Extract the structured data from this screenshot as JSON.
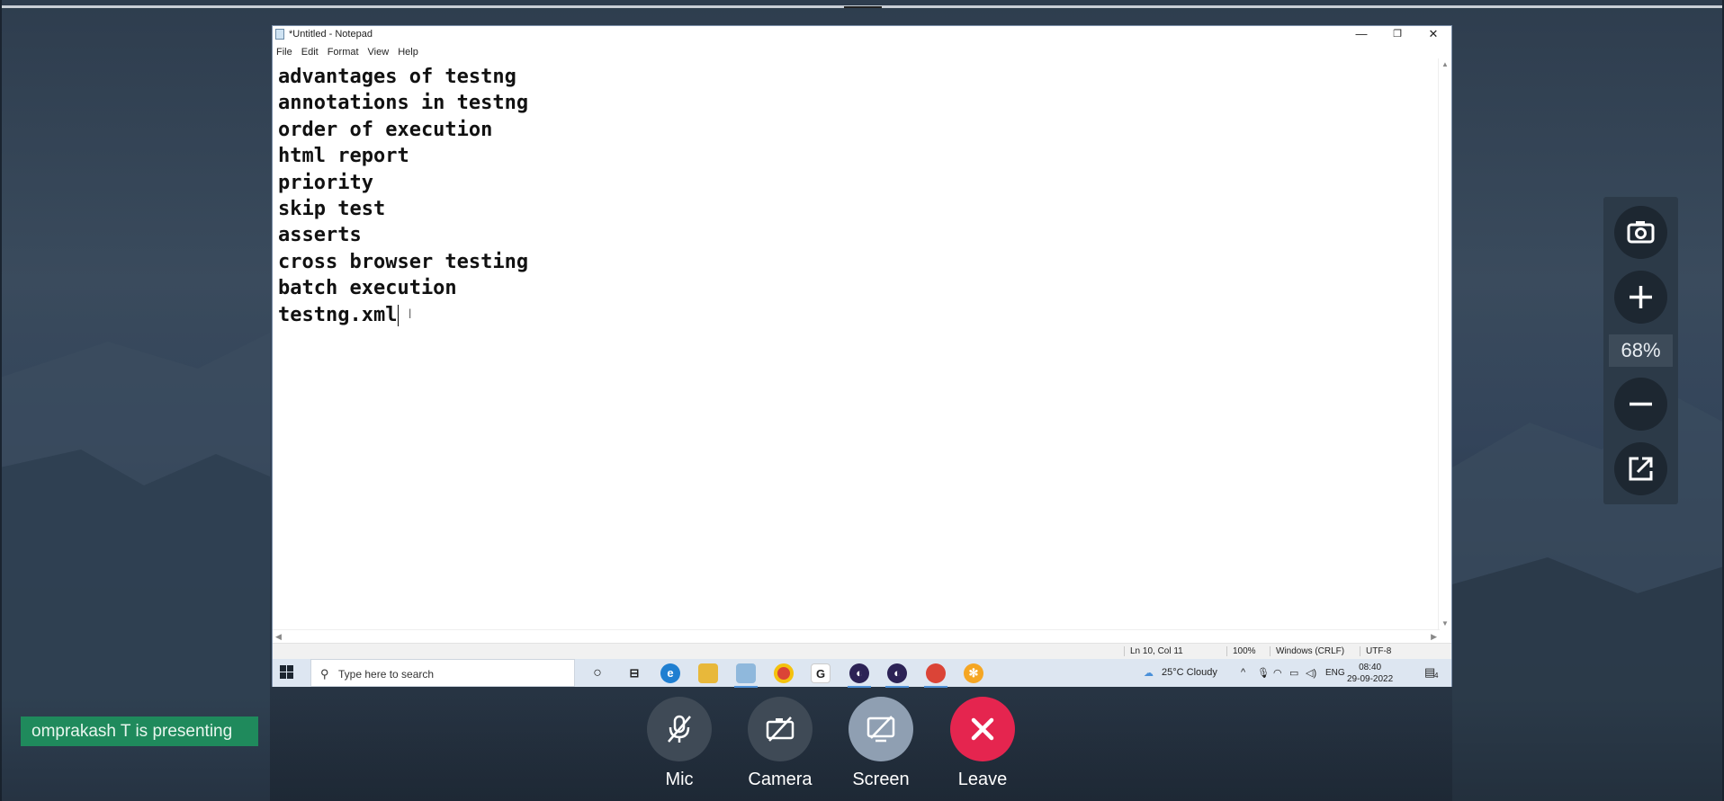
{
  "notepad": {
    "title": "*Untitled - Notepad",
    "menu": [
      "File",
      "Edit",
      "Format",
      "View",
      "Help"
    ],
    "controls": {
      "minimize": "—",
      "maximize": "❐",
      "close": "✕"
    },
    "lines": [
      "advantages of testng",
      "annotations in testng",
      "order of execution",
      "html report",
      "priority",
      "skip test",
      "asserts",
      "cross browser testing",
      "batch execution",
      "testng.xml"
    ],
    "status": {
      "position": "Ln 10, Col 11",
      "zoom": "100%",
      "line_ending": "Windows (CRLF)",
      "encoding": "UTF-8"
    }
  },
  "taskbar": {
    "search_placeholder": "Type here to search",
    "weather": "25°C  Cloudy",
    "language": "ENG",
    "time": "08:40",
    "date": "29-09-2022",
    "notifications": "4"
  },
  "zoom_panel": {
    "level": "68%",
    "buttons": [
      "camera-icon",
      "zoom-in-icon",
      "zoom-out-icon",
      "popout-icon"
    ]
  },
  "presenter": {
    "label": "omprakash T is presenting",
    "color": "#1f8a5c"
  },
  "controls": {
    "mic": "Mic",
    "camera": "Camera",
    "screen": "Screen",
    "leave": "Leave",
    "leave_color": "#e5254f"
  }
}
